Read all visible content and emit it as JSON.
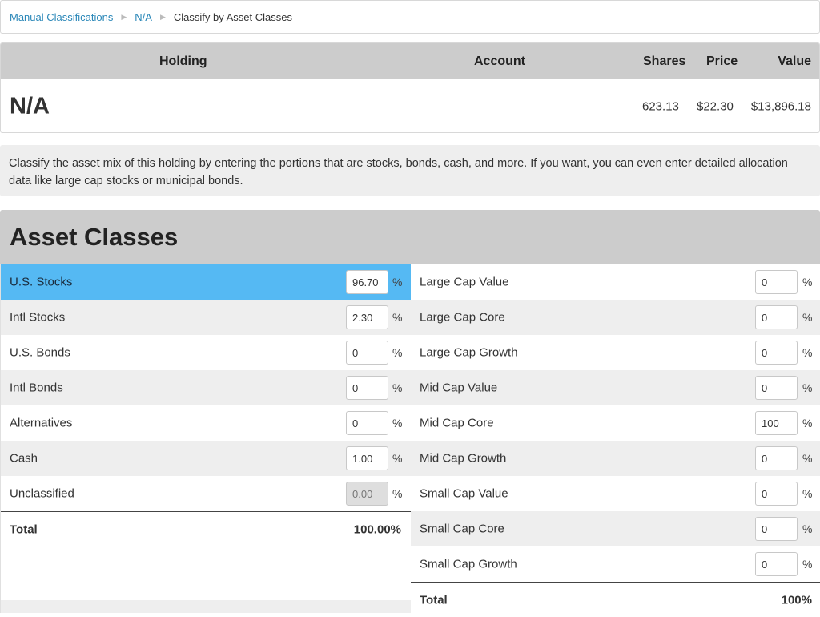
{
  "breadcrumb": {
    "items": [
      "Manual Classifications",
      "N/A",
      "Classify by Asset Classes"
    ],
    "separator": "▶"
  },
  "holding": {
    "headers": {
      "holding": "Holding",
      "account": "Account",
      "shares": "Shares",
      "price": "Price",
      "value": "Value"
    },
    "name": "N/A",
    "account": "",
    "shares": "623.13",
    "price": "$22.30",
    "value": "$13,896.18"
  },
  "info_text": "Classify the asset mix of this holding by entering the portions that are stocks, bonds, cash, and more. If you want, you can even enter detailed allocation data like large cap stocks or municipal bonds.",
  "asset_classes": {
    "title": "Asset Classes",
    "percent_sign": "%",
    "left": [
      {
        "label": "U.S. Stocks",
        "value": "96.70",
        "selected": true
      },
      {
        "label": "Intl Stocks",
        "value": "2.30"
      },
      {
        "label": "U.S. Bonds",
        "value": "0"
      },
      {
        "label": "Intl Bonds",
        "value": "0"
      },
      {
        "label": "Alternatives",
        "value": "0"
      },
      {
        "label": "Cash",
        "value": "1.00"
      },
      {
        "label": "Unclassified",
        "value": "0.00",
        "disabled": true
      }
    ],
    "left_total": {
      "label": "Total",
      "value": "100.00%"
    },
    "right": [
      {
        "label": "Large Cap Value",
        "value": "0"
      },
      {
        "label": "Large Cap Core",
        "value": "0"
      },
      {
        "label": "Large Cap Growth",
        "value": "0"
      },
      {
        "label": "Mid Cap Value",
        "value": "0"
      },
      {
        "label": "Mid Cap Core",
        "value": "100"
      },
      {
        "label": "Mid Cap Growth",
        "value": "0"
      },
      {
        "label": "Small Cap Value",
        "value": "0"
      },
      {
        "label": "Small Cap Core",
        "value": "0"
      },
      {
        "label": "Small Cap Growth",
        "value": "0"
      }
    ],
    "right_total": {
      "label": "Total",
      "value": "100%"
    }
  },
  "colors": {
    "accent": "#55b9f3",
    "link": "#2a87b8",
    "header_gray": "#cccccc",
    "stripe": "#eeeeee"
  }
}
